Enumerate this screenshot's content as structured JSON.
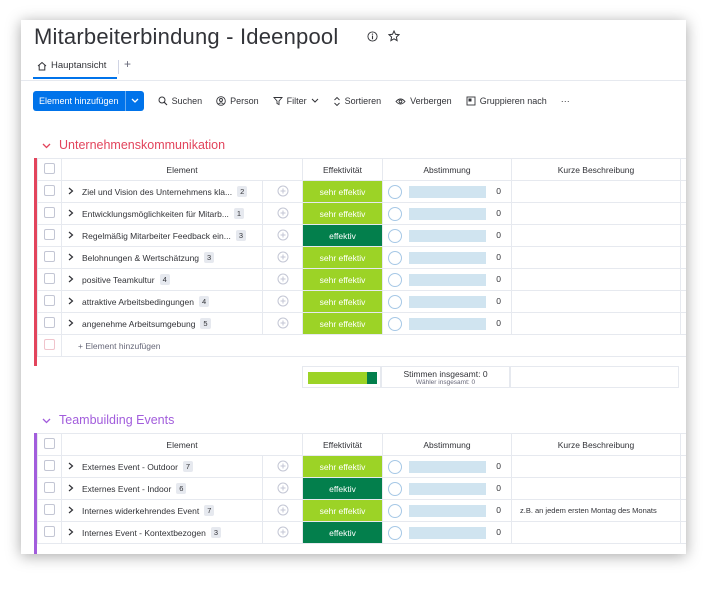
{
  "board": {
    "title": "Mitarbeiterbindung - Ideenpool",
    "icons": [
      "info-icon",
      "star-icon"
    ]
  },
  "tabs": [
    {
      "label": "Hauptansicht",
      "icon": "home-icon"
    }
  ],
  "tab_add": "+",
  "toolbar": {
    "new_item": "Element hinzufügen",
    "search": "Suchen",
    "person": "Person",
    "filter": "Filter",
    "sort": "Sortieren",
    "hide": "Verbergen",
    "group_by": "Gruppieren nach",
    "more": "···"
  },
  "columns": {
    "element": "Element",
    "effectiveness": "Effektivität",
    "vote": "Abstimmung",
    "description": "Kurze Beschreibung"
  },
  "colors": {
    "group1": "#e2445c",
    "group2": "#a25ddc",
    "sehr_effektiv": "#9cd326",
    "effektiv": "#037f4c"
  },
  "groups": [
    {
      "name": "Unternehmenskommunikation",
      "chevron": "˅",
      "rows": [
        {
          "name": "Ziel und Vision des Unternehmens kla...",
          "count": "2",
          "status": "sehr effektiv",
          "votes": "0",
          "description": ""
        },
        {
          "name": "Entwicklungsmöglichkeiten für Mitarb...",
          "count": "1",
          "status": "sehr effektiv",
          "votes": "0",
          "description": ""
        },
        {
          "name": "Regelmäßig Mitarbeiter Feedback ein...",
          "count": "3",
          "status": "effektiv",
          "votes": "0",
          "description": ""
        },
        {
          "name": "Belohnungen & Wertschätzung",
          "count": "3",
          "status": "sehr effektiv",
          "votes": "0",
          "description": ""
        },
        {
          "name": "positive Teamkultur",
          "count": "4",
          "status": "sehr effektiv",
          "votes": "0",
          "description": ""
        },
        {
          "name": "attraktive Arbeitsbedingungen",
          "count": "4",
          "status": "sehr effektiv",
          "votes": "0",
          "description": ""
        },
        {
          "name": "angenehme Arbeitsumgebung",
          "count": "5",
          "status": "sehr effektiv",
          "votes": "0",
          "description": ""
        }
      ],
      "add_item": "+ Element hinzufügen",
      "summary": {
        "total_votes": "Stimmen insgesamt: 0",
        "total_voters": "Wähler insgesamt: 0",
        "sehr_effektiv_fraction": 0.857,
        "effektiv_fraction": 0.143
      }
    },
    {
      "name": "Teambuilding Events",
      "chevron": "˅",
      "rows": [
        {
          "name": "Externes Event - Outdoor",
          "count": "7",
          "status": "sehr effektiv",
          "votes": "0",
          "description": ""
        },
        {
          "name": "Externes Event - Indoor",
          "count": "6",
          "status": "effektiv",
          "votes": "0",
          "description": ""
        },
        {
          "name": "Internes widerkehrendes Event",
          "count": "7",
          "status": "sehr effektiv",
          "votes": "0",
          "description": "z.B. an jedem ersten Montag des Monats"
        },
        {
          "name": "Internes Event - Kontextbezogen",
          "count": "3",
          "status": "effektiv",
          "votes": "0",
          "description": ""
        }
      ]
    }
  ]
}
